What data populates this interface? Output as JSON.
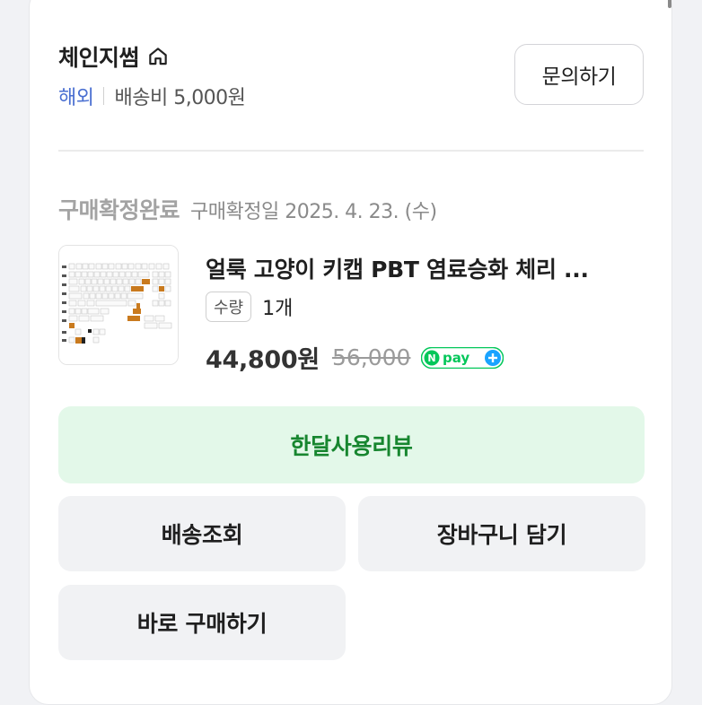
{
  "seller": {
    "name": "체인지썸",
    "region": "해외",
    "shipping_fee": "배송비 5,000원"
  },
  "inquiry_label": "문의하기",
  "order": {
    "status": "구매확정완료",
    "confirm_date": "구매확정일 2025. 4. 23. (수)"
  },
  "product": {
    "name": "얼룩 고양이 키캡 PBT 염료승화 체리 ...",
    "quantity_label": "수량",
    "quantity": "1개",
    "price": "44,800원",
    "original_price": "56,000",
    "payment_badge": "N pay +"
  },
  "actions": {
    "review": "한달사용리뷰",
    "track_shipping": "배송조회",
    "add_to_cart": "장바구니 담기",
    "buy_now": "바로 구매하기"
  },
  "colors": {
    "accent_blue": "#4a6fd1",
    "review_green": "#17862f",
    "review_bg": "#e3f8e9",
    "npay_green": "#03c75a"
  }
}
